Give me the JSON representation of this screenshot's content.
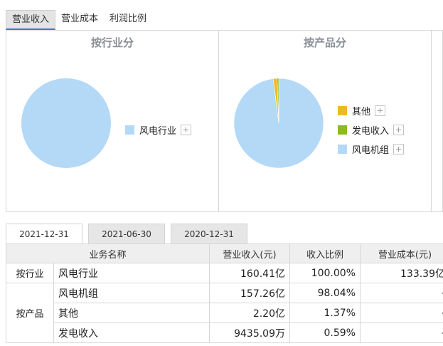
{
  "top_tabs": [
    {
      "label": "营业收入",
      "active": true
    },
    {
      "label": "营业成本",
      "active": false
    },
    {
      "label": "利润比例",
      "active": false
    }
  ],
  "panels": {
    "industry": {
      "title": "按行业分",
      "legend": [
        {
          "label": "风电行业",
          "color": "#b3d9f7"
        }
      ]
    },
    "product": {
      "title": "按产品分",
      "legend": [
        {
          "label": "其他",
          "color": "#f2b822"
        },
        {
          "label": "发电收入",
          "color": "#8bbb1e"
        },
        {
          "label": "风电机组",
          "color": "#b3d9f7"
        }
      ]
    }
  },
  "chart_data": [
    {
      "type": "pie",
      "title": "按行业分",
      "labels": [
        "风电行业"
      ],
      "values": [
        100.0
      ],
      "colors": [
        "#b3d9f7"
      ]
    },
    {
      "type": "pie",
      "title": "按产品分",
      "labels": [
        "风电机组",
        "其他",
        "发电收入"
      ],
      "values": [
        98.04,
        1.37,
        0.59
      ],
      "colors": [
        "#b3d9f7",
        "#f2b822",
        "#8bbb1e"
      ]
    }
  ],
  "date_tabs": [
    {
      "label": "2021-12-31",
      "active": true
    },
    {
      "label": "2021-06-30",
      "active": false
    },
    {
      "label": "2020-12-31",
      "active": false
    }
  ],
  "table": {
    "headers": [
      "业务名称",
      "营业收入(元)",
      "收入比例",
      "营业成本(元)"
    ],
    "groups": {
      "industry": "按行业",
      "product": "按产品"
    },
    "rows": [
      {
        "name": "风电行业",
        "revenue": "160.41亿",
        "ratio": "100.00%",
        "cost": "133.39亿"
      },
      {
        "name": "风电机组",
        "revenue": "157.26亿",
        "ratio": "98.04%",
        "cost": "-"
      },
      {
        "name": "其他",
        "revenue": "2.20亿",
        "ratio": "1.37%",
        "cost": "-"
      },
      {
        "name": "发电收入",
        "revenue": "9435.09万",
        "ratio": "0.59%",
        "cost": "-"
      }
    ]
  }
}
